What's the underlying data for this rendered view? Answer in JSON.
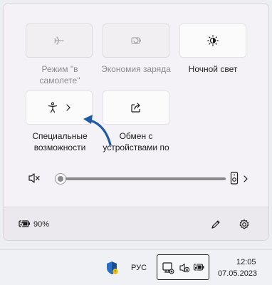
{
  "quick_settings": {
    "tiles": [
      {
        "label": "Режим \"в самолете\"",
        "icon": "airplane-icon",
        "enabled": false
      },
      {
        "label": "Экономия заряда",
        "icon": "battery-saver-icon",
        "enabled": false
      },
      {
        "label": "Ночной свет",
        "icon": "brightness-icon",
        "enabled": true
      },
      {
        "label": "Специальные возможности",
        "icon": "accessibility-icon",
        "enabled": true,
        "has_chevron": true
      },
      {
        "label": "Обмен с устройствами по",
        "icon": "share-icon",
        "enabled": true
      }
    ],
    "volume": {
      "level": 0,
      "muted": true
    }
  },
  "footer": {
    "battery_percent": "90%"
  },
  "taskbar": {
    "language": "РУС",
    "time": "12:05",
    "date": "07.05.2023"
  },
  "colors": {
    "accent_arrow": "#1f5aa6",
    "panel_bg": "#f4f2f6",
    "footer_bg": "#ebe8ee",
    "taskbar_bg": "#eff1f4"
  }
}
